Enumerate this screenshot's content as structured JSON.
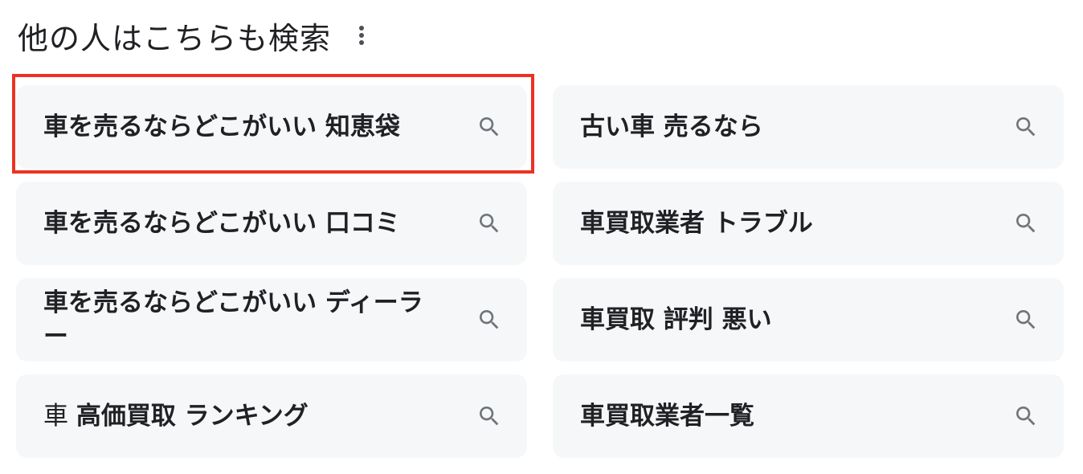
{
  "header": {
    "title": "他の人はこちらも検索",
    "more_icon": "more-vert-icon"
  },
  "colors": {
    "chip_background": "#f6f7f9",
    "text": "#202124",
    "icon": "#70757a",
    "highlight": "#ea3323"
  },
  "suggestions": [
    {
      "plain": "",
      "bold": "車を売るならどこがいい 知恵袋",
      "icon": "search-icon"
    },
    {
      "plain": "",
      "bold": "古い車 売るなら",
      "icon": "search-icon"
    },
    {
      "plain": "",
      "bold": "車を売るならどこがいい 口コミ",
      "icon": "search-icon"
    },
    {
      "plain": "",
      "bold": "車買取業者 トラブル",
      "icon": "search-icon"
    },
    {
      "plain": "",
      "bold": "車を売るならどこがいい ディーラー",
      "icon": "search-icon"
    },
    {
      "plain": "",
      "bold": "車買取 評判 悪い",
      "icon": "search-icon"
    },
    {
      "plain": "車 ",
      "bold": "高価買取 ランキング",
      "icon": "search-icon"
    },
    {
      "plain": "",
      "bold": "車買取業者一覧",
      "icon": "search-icon"
    }
  ]
}
